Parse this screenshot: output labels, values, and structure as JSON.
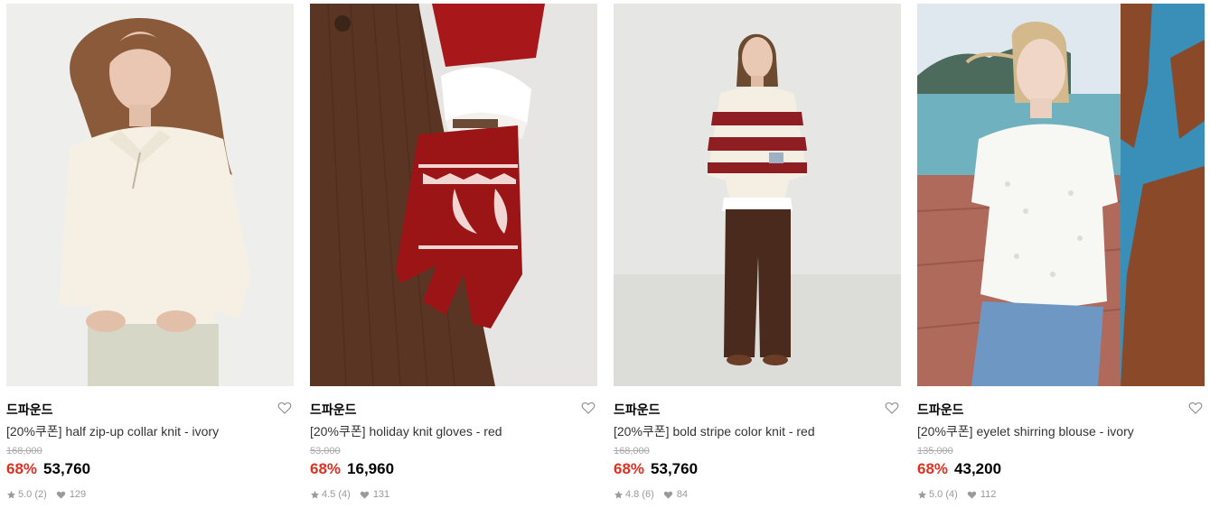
{
  "products": [
    {
      "brand": "드파운드",
      "name": "[20%쿠폰] half zip-up collar knit - ivory",
      "original_price": "168,000",
      "discount": "68%",
      "price": "53,760",
      "rating": "5.0",
      "reviews": "(2)",
      "likes": "129",
      "image": "model in ivory half zip-up collar knit"
    },
    {
      "brand": "드파운드",
      "name": "[20%쿠폰] holiday knit gloves - red",
      "original_price": "53,000",
      "discount": "68%",
      "price": "16,960",
      "rating": "4.5",
      "reviews": "(4)",
      "likes": "131",
      "image": "hand wearing red fair-isle knit glove"
    },
    {
      "brand": "드파운드",
      "name": "[20%쿠폰] bold stripe color knit - red",
      "original_price": "168,000",
      "discount": "68%",
      "price": "53,760",
      "rating": "4.8",
      "reviews": "(6)",
      "likes": "84",
      "image": "model in red and ivory bold stripe knit"
    },
    {
      "brand": "드파운드",
      "name": "[20%쿠폰] eyelet shirring blouse - ivory",
      "original_price": "135,000",
      "discount": "68%",
      "price": "43,200",
      "rating": "5.0",
      "reviews": "(4)",
      "likes": "112",
      "image": "model in ivory eyelet shirring blouse by the sea"
    }
  ],
  "icons": {
    "wishlist": "heart-outline-icon",
    "rating": "star-icon",
    "likes": "heart-filled-icon"
  },
  "colors": {
    "discount": "#e0301e",
    "price": "#000000",
    "original_price": "#aaaaaa",
    "meta": "#999999"
  }
}
